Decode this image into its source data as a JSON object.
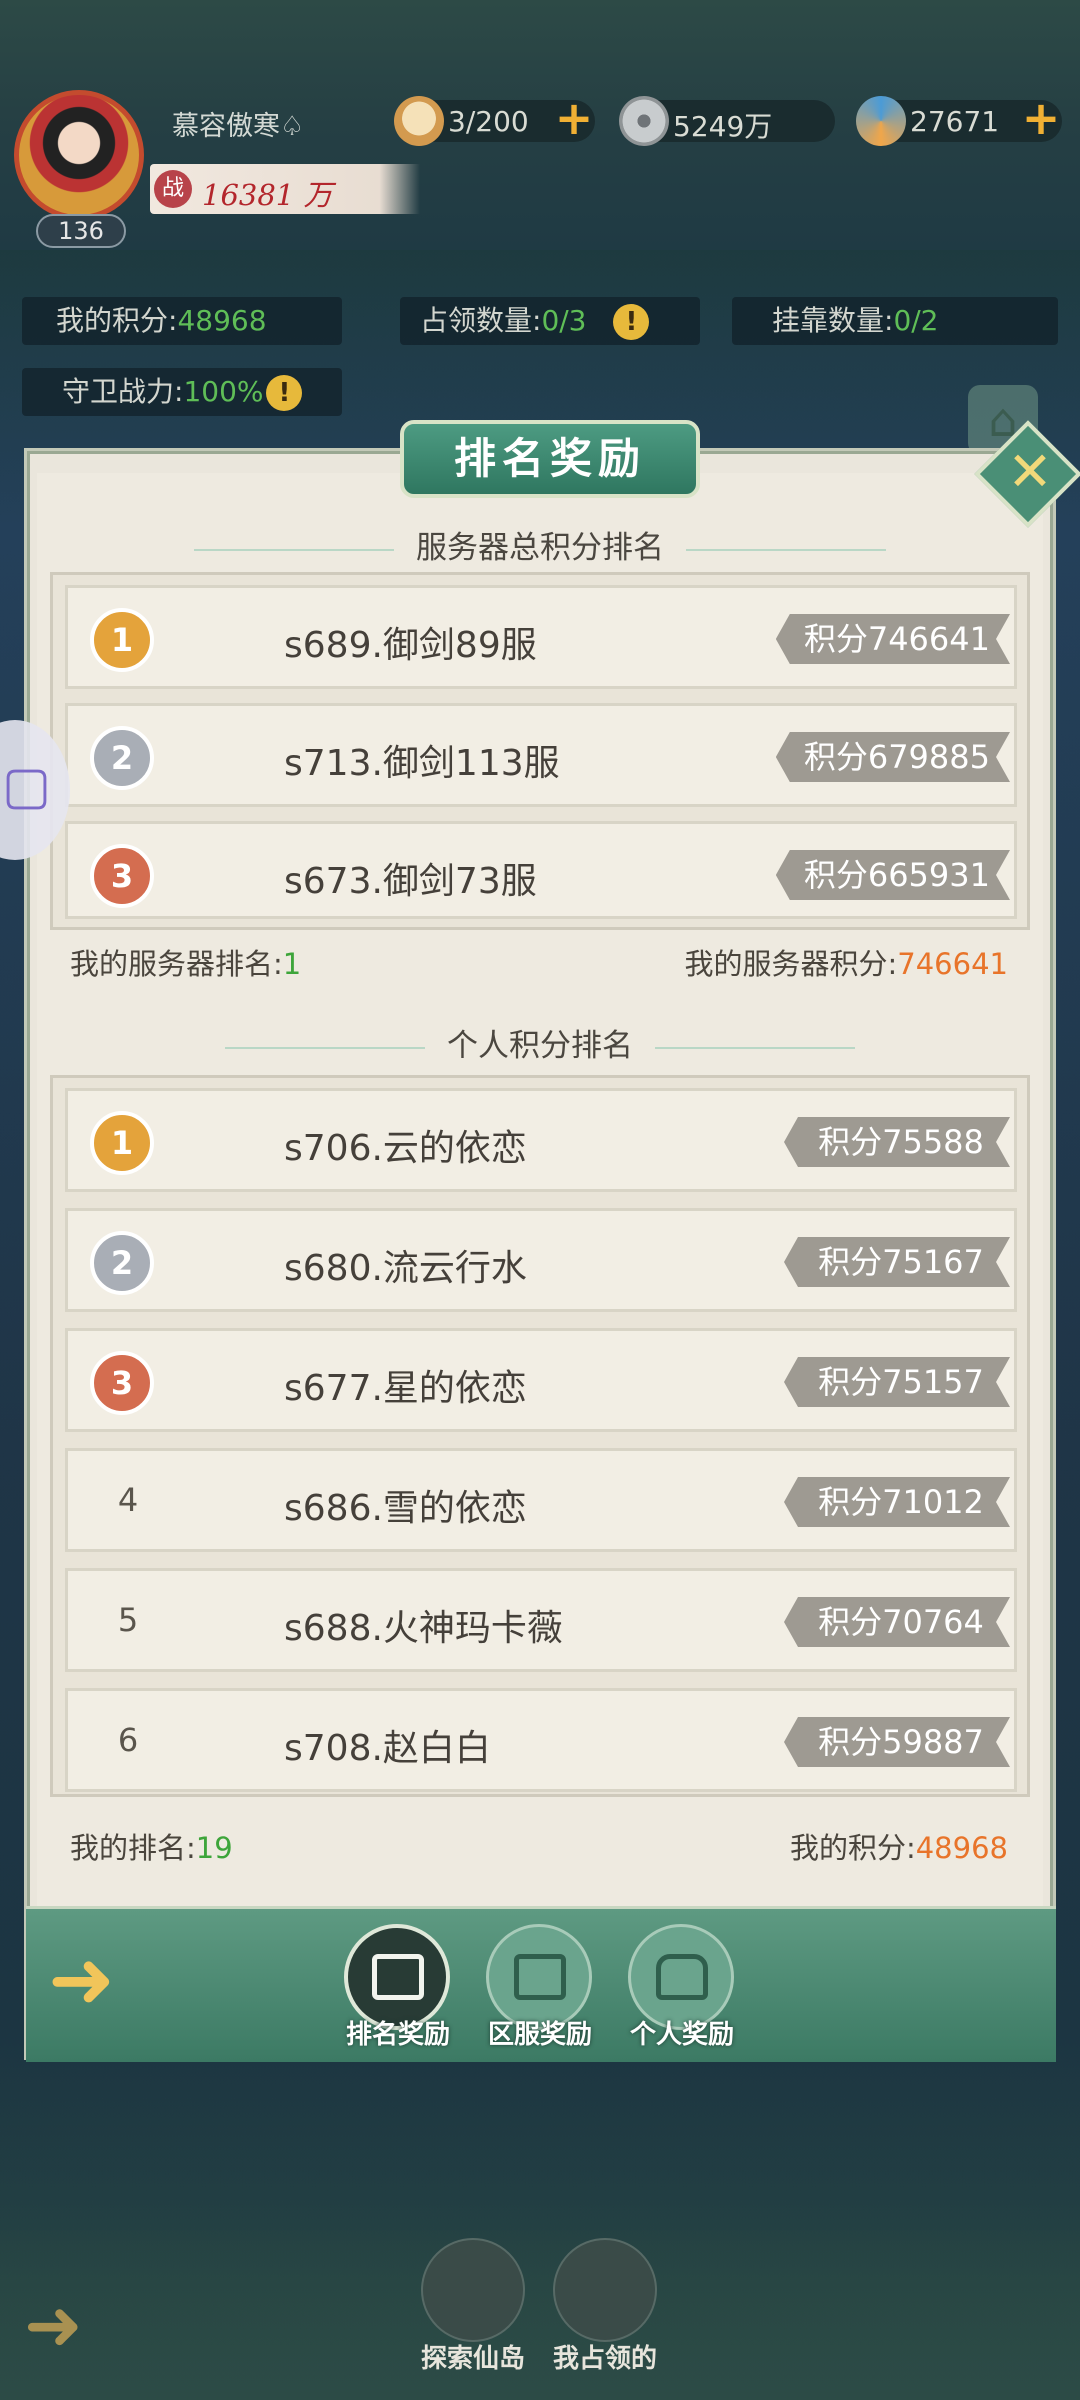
{
  "player": {
    "name": "慕容傲寒♤",
    "level": "136",
    "power_icon": "战",
    "power": "16381 万"
  },
  "resources": [
    {
      "icon": "bun-icon",
      "value": "3/200"
    },
    {
      "icon": "coin-icon",
      "value": "5249万"
    },
    {
      "icon": "spiral-icon",
      "value": "27671"
    }
  ],
  "stats": {
    "my_points_label": "我的积分:",
    "my_points_value": "48968",
    "occupy_label": "占领数量:",
    "occupy_value": "0/3",
    "attach_label": "挂靠数量:",
    "attach_value": "0/2",
    "guard_label": "守卫战力:",
    "guard_value": "100%"
  },
  "modal": {
    "title": "排名奖励",
    "close_glyph": "✕"
  },
  "server_ranking": {
    "title": "服务器总积分排名",
    "rows": [
      {
        "rank": "1",
        "name": "s689.御剑89服",
        "score": "积分746641"
      },
      {
        "rank": "2",
        "name": "s713.御剑113服",
        "score": "积分679885"
      },
      {
        "rank": "3",
        "name": "s673.御剑73服",
        "score": "积分665931"
      }
    ],
    "my_rank_label": "我的服务器排名:",
    "my_rank_value": "1",
    "my_score_label": "我的服务器积分:",
    "my_score_value": "746641"
  },
  "personal_ranking": {
    "title": "个人积分排名",
    "rows": [
      {
        "rank": "1",
        "name": "s706.云的依恋",
        "score": "积分75588"
      },
      {
        "rank": "2",
        "name": "s680.流云行水",
        "score": "积分75167"
      },
      {
        "rank": "3",
        "name": "s677.星的依恋",
        "score": "积分75157"
      },
      {
        "rank": "4",
        "name": "s686.雪的依恋",
        "score": "积分71012"
      },
      {
        "rank": "5",
        "name": "s688.火神玛卡薇",
        "score": "积分70764"
      },
      {
        "rank": "6",
        "name": "s708.赵白白",
        "score": "积分59887"
      }
    ],
    "my_rank_label": "我的排名:",
    "my_rank_value": "19",
    "my_score_label": "我的积分:",
    "my_score_value": "48968"
  },
  "tabs": [
    {
      "label": "排名奖励",
      "active": true
    },
    {
      "label": "区服奖励",
      "active": false
    },
    {
      "label": "个人奖励",
      "active": false
    }
  ],
  "bottom_nav": [
    {
      "label": "探索仙岛"
    },
    {
      "label": "我占领的"
    }
  ],
  "colors": {
    "accent_green": "#3d7b63",
    "score_orange": "#e8742a",
    "value_green": "#3da53a"
  }
}
